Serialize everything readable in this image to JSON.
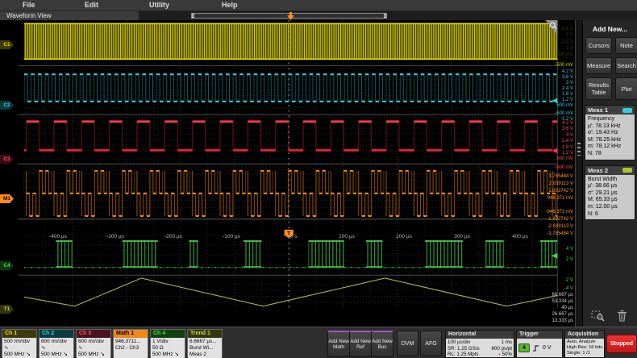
{
  "menu": {
    "items": [
      "File",
      "Edit",
      "Utility",
      "Help"
    ]
  },
  "tab": {
    "label": "Waveform View"
  },
  "sidebar": {
    "title": "Add New...",
    "buttons": [
      "Cursors",
      "Note",
      "Measure",
      "Search",
      "Results Table",
      "Plot"
    ],
    "meas1": {
      "title": "Meas 1",
      "name": "Frequency",
      "stats": [
        "µ': 78.13 kHz",
        "σ': 19.43 Hz",
        "M: 78.25 kHz",
        "m: 78.12 kHz",
        "N: 78"
      ]
    },
    "meas2": {
      "title": "Meas 2",
      "name": "Burst Width",
      "stats": [
        "µ': 38.66 µs",
        "σ': 29.21 µs",
        "M: 65.33 µs",
        "m: 12.00 µs",
        "N: 6"
      ]
    }
  },
  "wave": {
    "x_labels": [
      "-400 µs",
      "-300 µs",
      "-200 µs",
      "-100 µs",
      "0 s",
      "100 µs",
      "200 µs",
      "300 µs",
      "400 µs"
    ],
    "ch1_labels": [
      "2.5 V",
      "2 V",
      "1.5 V",
      "1 V",
      "500 mV",
      "-500 mV"
    ],
    "ch2_labels": [
      "4.2 V",
      "3.6 V",
      "3 V",
      "2.4 V",
      "1.8 V",
      "1.2 V",
      "600 mV",
      "-600 mV",
      "-1.2 V"
    ],
    "ch3_labels": [
      "4.2 V",
      "3.6 V",
      "3 V",
      "2.4 V",
      "1.8 V",
      "1.2 V",
      "600 mV",
      "-600 mV"
    ],
    "math_labels": [
      "3.785484 V",
      "2.839113 V",
      "1.892742 V",
      "946.371 mV",
      "-946.371 mV",
      "-1.892742 V",
      "-2.839113 V",
      "-3.785484 V"
    ],
    "ch4_labels": [
      "4 V",
      "2 V",
      "-2 V",
      "-4 V"
    ],
    "trend_labels": [
      "66.667 µs",
      "53.334 µs",
      "40 µs",
      "26.667 µs",
      "13.333 µs"
    ],
    "handles": [
      "C1",
      "C2",
      "C3",
      "M1",
      "C4",
      "T1"
    ],
    "trigger_marker": "T",
    "colors": {
      "ch1": "#d8d200",
      "ch2": "#35ccd8",
      "ch3": "#ff4858",
      "math": "#ff9818",
      "ch4": "#4fd44f",
      "trend": "#a8ae52",
      "trigger": "#ff8c1a",
      "stopped": "#e02020"
    }
  },
  "badges": {
    "ch1": {
      "label": "Ch 1",
      "line1": "500 mV/div",
      "line3": "500 MHz"
    },
    "ch2": {
      "label": "Ch 2",
      "line1": "600 mV/div",
      "line3": "500 MHz"
    },
    "ch3": {
      "label": "Ch 3",
      "line1": "600 mV/div",
      "line3": "500 MHz"
    },
    "math1": {
      "label": "Math 1",
      "line1": "946.3711...",
      "line2": "Ch2 - Ch3"
    },
    "ch4": {
      "label": "Ch 4",
      "line1": "1 V/div",
      "line2": "50 Ω",
      "line3": "500 MHz"
    },
    "trend1": {
      "label": "Trend 1",
      "line1": "6.6667 µs...",
      "line2": "Burst Wi...",
      "line3": "Meas 2"
    }
  },
  "icons": {
    "coupling": "∿",
    "bandwidth": "↘",
    "horizontal_position": "●"
  },
  "toolbar": {
    "add_math": "Add New Math",
    "add_ref": "Add New Ref",
    "add_bus": "Add New Bus",
    "dvm": "DVM",
    "afg": "AFG"
  },
  "horizontal": {
    "title": "Horizontal",
    "rows": [
      [
        "100 µs/div",
        "1 ms"
      ],
      [
        "SR: 1.25 GS/s",
        "800 ps/pt"
      ],
      [
        "RL: 1.25 Mpts",
        "50%"
      ]
    ]
  },
  "trigger": {
    "title": "Trigger",
    "source": "4",
    "level": "0 V"
  },
  "acquisition": {
    "title": "Acquisition",
    "lines": [
      "Auto,   Analyze",
      "High Res: 16 bits",
      "Single: 1 /1"
    ]
  },
  "run_state": {
    "label": "Stopped"
  }
}
